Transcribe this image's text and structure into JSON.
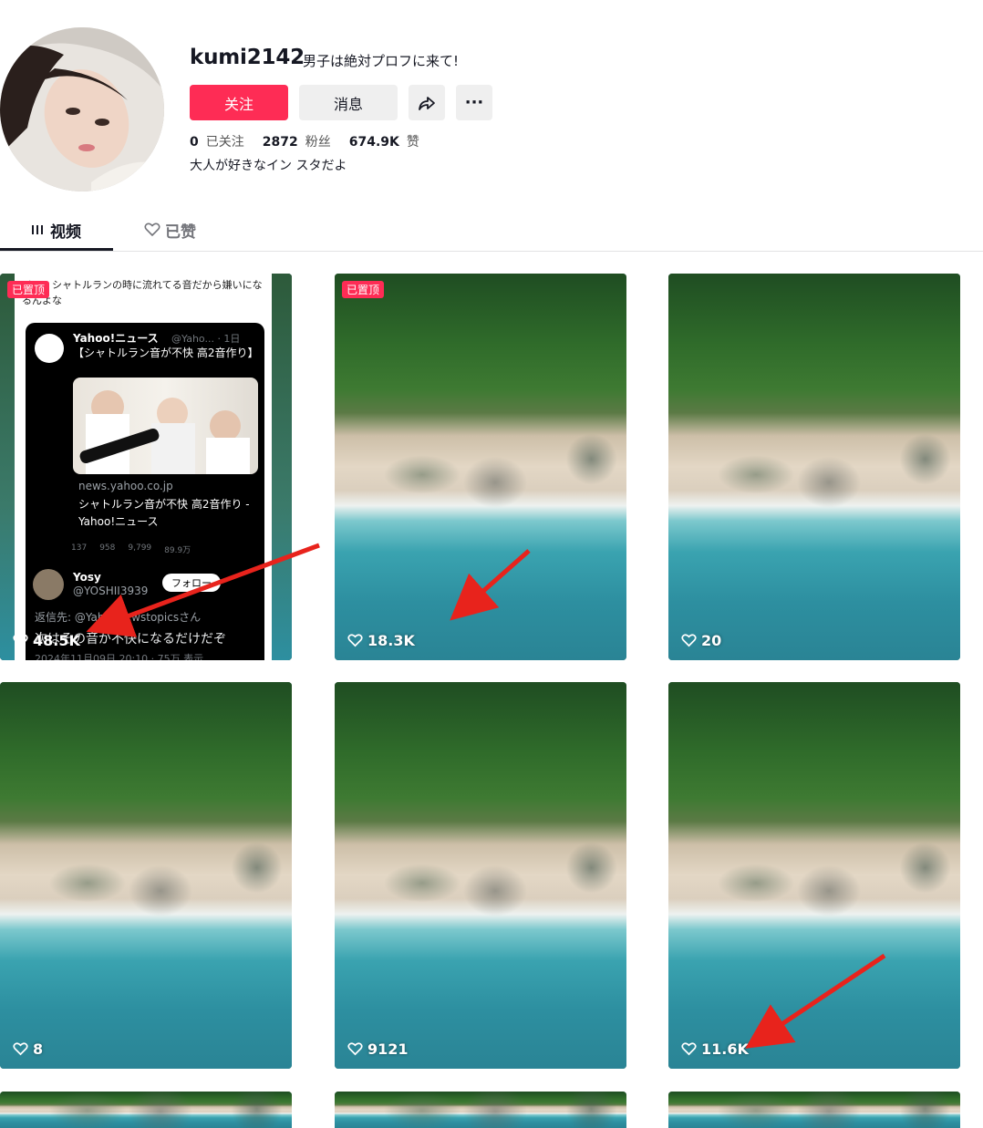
{
  "profile": {
    "username": "kumi2142",
    "nickname": "男子は絶対プロフに来て!",
    "follow_label": "关注",
    "message_label": "消息",
    "more_label": "···",
    "bio": "大人が好きなイン スタだよ",
    "stats": [
      {
        "value": "0",
        "label": "已关注"
      },
      {
        "value": "2872",
        "label": "粉丝"
      },
      {
        "value": "674.9K",
        "label": "赞"
      }
    ]
  },
  "tabs": [
    {
      "label": "视频",
      "icon": "grid-icon",
      "active": true
    },
    {
      "label": "已赞",
      "icon": "heart-outline-icon",
      "active": false
    }
  ],
  "videos": [
    {
      "likes": "48.5K",
      "pinned": "已置顶",
      "thumbnail": "tweet-screenshot"
    },
    {
      "likes": "18.3K",
      "pinned": "已置顶",
      "thumbnail": "beach"
    },
    {
      "likes": "20",
      "thumbnail": "beach"
    },
    {
      "likes": "8",
      "thumbnail": "beach"
    },
    {
      "likes": "9121",
      "thumbnail": "beach"
    },
    {
      "likes": "11.6K",
      "thumbnail": "beach"
    }
  ],
  "tweet": {
    "caption": "イン　シャトルランの時に流れてる音だから嫌いになるんよな",
    "account_name": "Yahoo!ニュース",
    "account_handle": "@Yaho... · 1日",
    "text": "【シャトルラン音が不快 高2音作り】",
    "link_domain": "news.yahoo.co.jp",
    "link_title": "シャトルラン音が不快 高2音作り - Yahoo!ニュース",
    "metrics": [
      "137",
      "958",
      "9,799",
      "89.9万"
    ],
    "reply_name": "Yosy",
    "reply_handle": "@YOSHII3939",
    "follow_btn": "フォロー",
    "reply_to": "返信先: @Yahoonewstopicsさん",
    "reply_text": "次はその音が不快になるだけだぞ",
    "reply_date": "2024年11月09日 20:10 · 75万 表示"
  },
  "colors": {
    "accent": "#fe2c55",
    "arrow": "#e8231c"
  }
}
